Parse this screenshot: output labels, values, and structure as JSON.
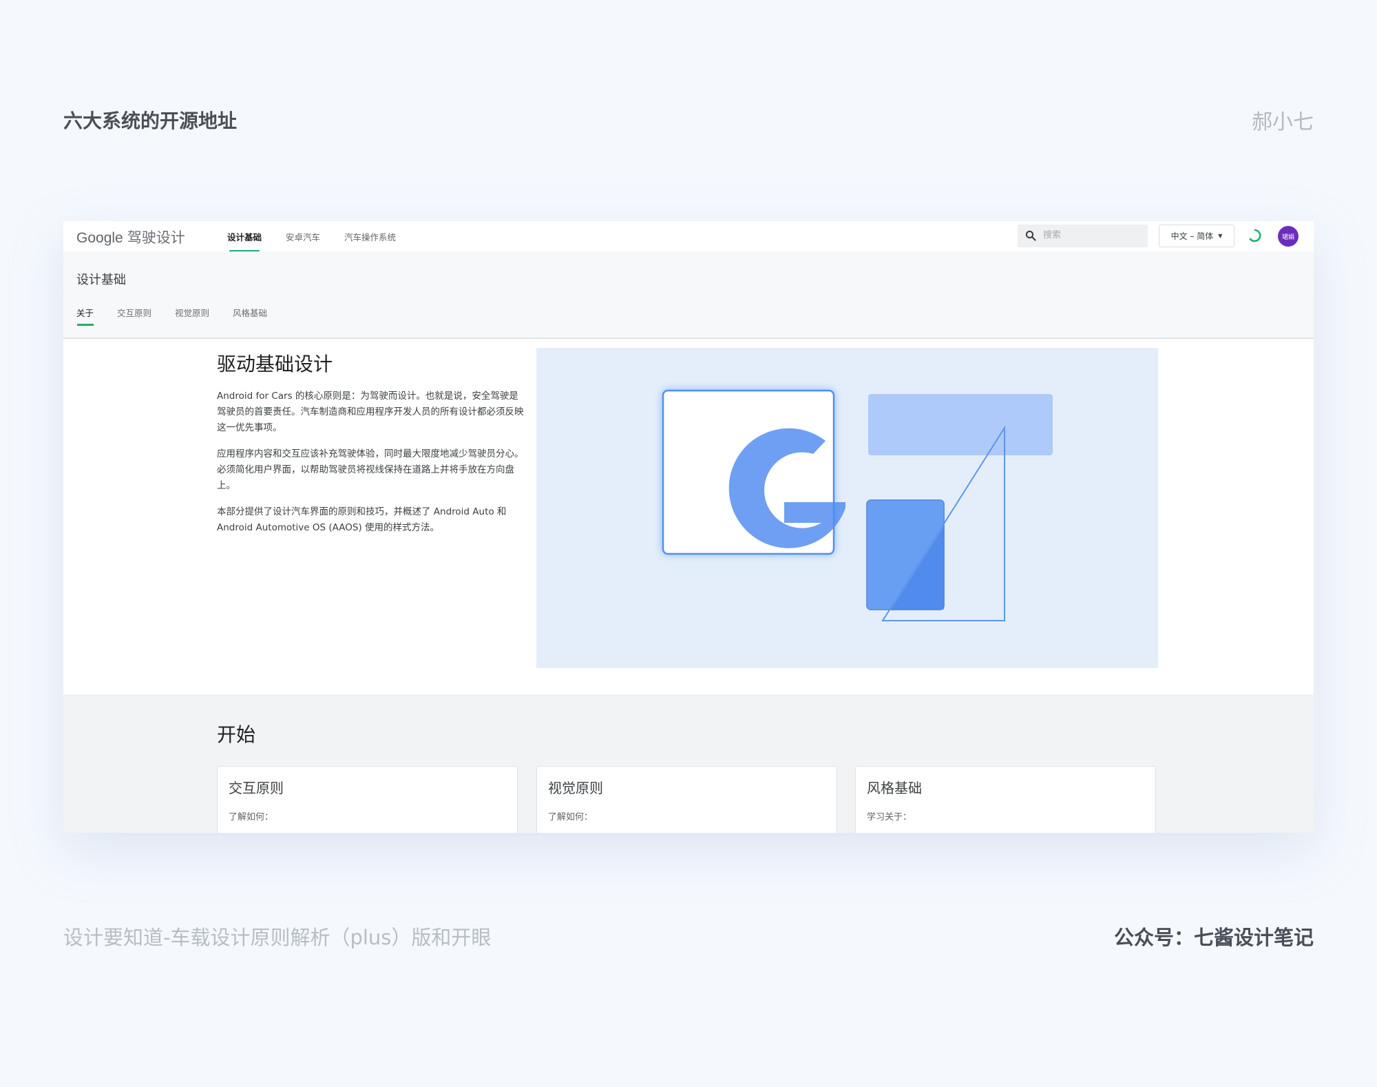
{
  "page": {
    "title": "六大系统的开源地址",
    "author": "郝小七",
    "footer_left": "设计要知道-车载设计原则解析（plus）版和开眼",
    "footer_right": "公众号：七酱设计笔记"
  },
  "header": {
    "logo_brand": "Google",
    "logo_suffix": "驾驶设计",
    "nav": [
      {
        "label": "设计基础",
        "active": true
      },
      {
        "label": "安卓汽车",
        "active": false
      },
      {
        "label": "汽车操作系统",
        "active": false
      }
    ],
    "search_placeholder": "搜索",
    "language": "中文 – 简体",
    "avatar_text": "珺娟",
    "accent_color": "#1fae6e",
    "avatar_color": "#6a2dbb"
  },
  "subheader": {
    "title": "设计基础",
    "tabs": [
      {
        "label": "关于",
        "active": true
      },
      {
        "label": "交互原则",
        "active": false
      },
      {
        "label": "视觉原则",
        "active": false
      },
      {
        "label": "风格基础",
        "active": false
      }
    ]
  },
  "intro": {
    "heading": "驱动基础设计",
    "paragraphs": [
      "Android for Cars 的核心原则是：为驾驶而设计。也就是说，安全驾驶是驾驶员的首要责任。汽车制造商和应用程序开发人员的所有设计都必须反映这一优先事项。",
      "应用程序内容和交互应该补充驾驶体验，同时最大限度地减少驾驶员分心。必须简化用户界面，以帮助驾驶员将视线保持在道路上并将手放在方向盘上。",
      "本部分提供了设计汽车界面的原则和技巧，并概述了 Android Auto 和 Android Automotive OS (AAOS) 使用的样式方法。"
    ]
  },
  "start": {
    "title": "开始",
    "cards": [
      {
        "title": "交互原则",
        "subtitle": "了解如何："
      },
      {
        "title": "视觉原则",
        "subtitle": "了解如何："
      },
      {
        "title": "风格基础",
        "subtitle": "学习关于："
      }
    ]
  }
}
